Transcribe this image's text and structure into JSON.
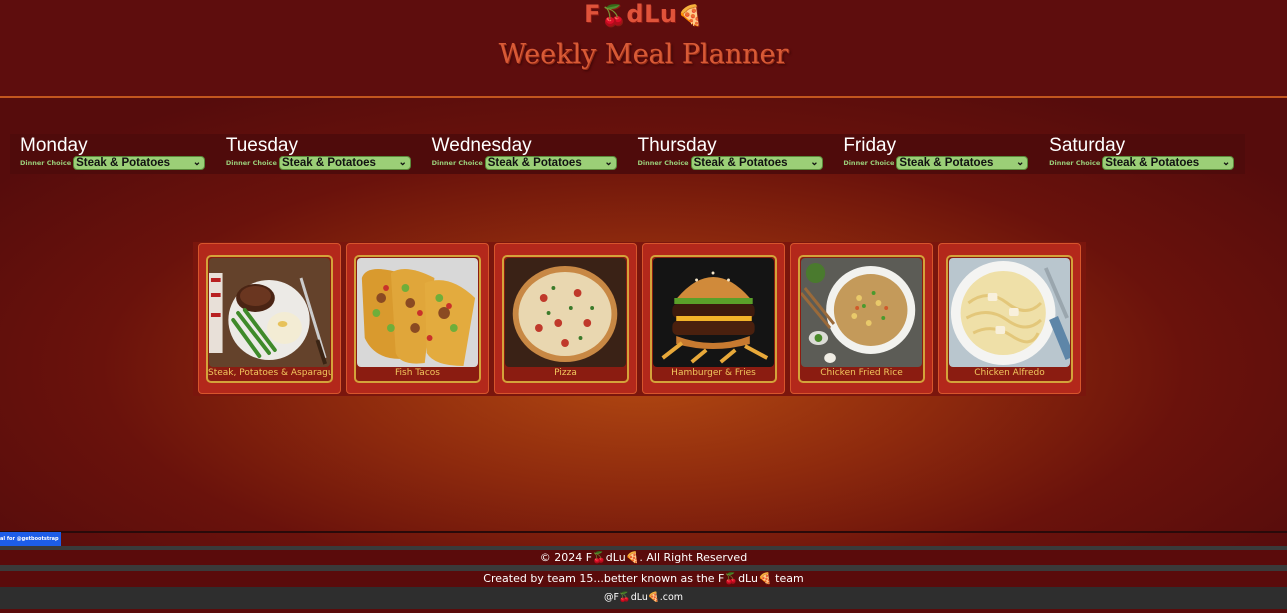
{
  "brand": {
    "logo_pre": "F",
    "logo_cherry": "🍒",
    "logo_mid": "dLu",
    "logo_pizza": "🍕"
  },
  "header": {
    "title": "Weekly Meal Planner"
  },
  "days": [
    {
      "name": "Monday",
      "label": "Dinner Choice",
      "choice": "Steak & Potatoes"
    },
    {
      "name": "Tuesday",
      "label": "Dinner Choice",
      "choice": "Steak & Potatoes"
    },
    {
      "name": "Wednesday",
      "label": "Dinner Choice",
      "choice": "Steak & Potatoes"
    },
    {
      "name": "Thursday",
      "label": "Dinner Choice",
      "choice": "Steak & Potatoes"
    },
    {
      "name": "Friday",
      "label": "Dinner Choice",
      "choice": "Steak & Potatoes"
    },
    {
      "name": "Saturday",
      "label": "Dinner Choice",
      "choice": "Steak & Potatoes"
    }
  ],
  "meals": [
    {
      "label": "Steak, Potatoes & Asparagus"
    },
    {
      "label": "Fish Tacos"
    },
    {
      "label": "Pizza"
    },
    {
      "label": "Hamburger & Fries"
    },
    {
      "label": "Chicken Fried Rice"
    },
    {
      "label": "Chicken Alfredo"
    }
  ],
  "tooltip": {
    "text": "al for @getbootstrap"
  },
  "footer": {
    "copyright": "© 2024 F🍒dLu🍕. All Right Reserved",
    "credit": "Created by team 15...better known as the F🍒dLu🍕 team",
    "handle": "@F🍒dLu🍕.com"
  },
  "colors": {
    "accent": "#d85a36",
    "select_bg": "#9bcf77",
    "card_border": "#d4a33a",
    "label_text": "#f1c75e"
  }
}
